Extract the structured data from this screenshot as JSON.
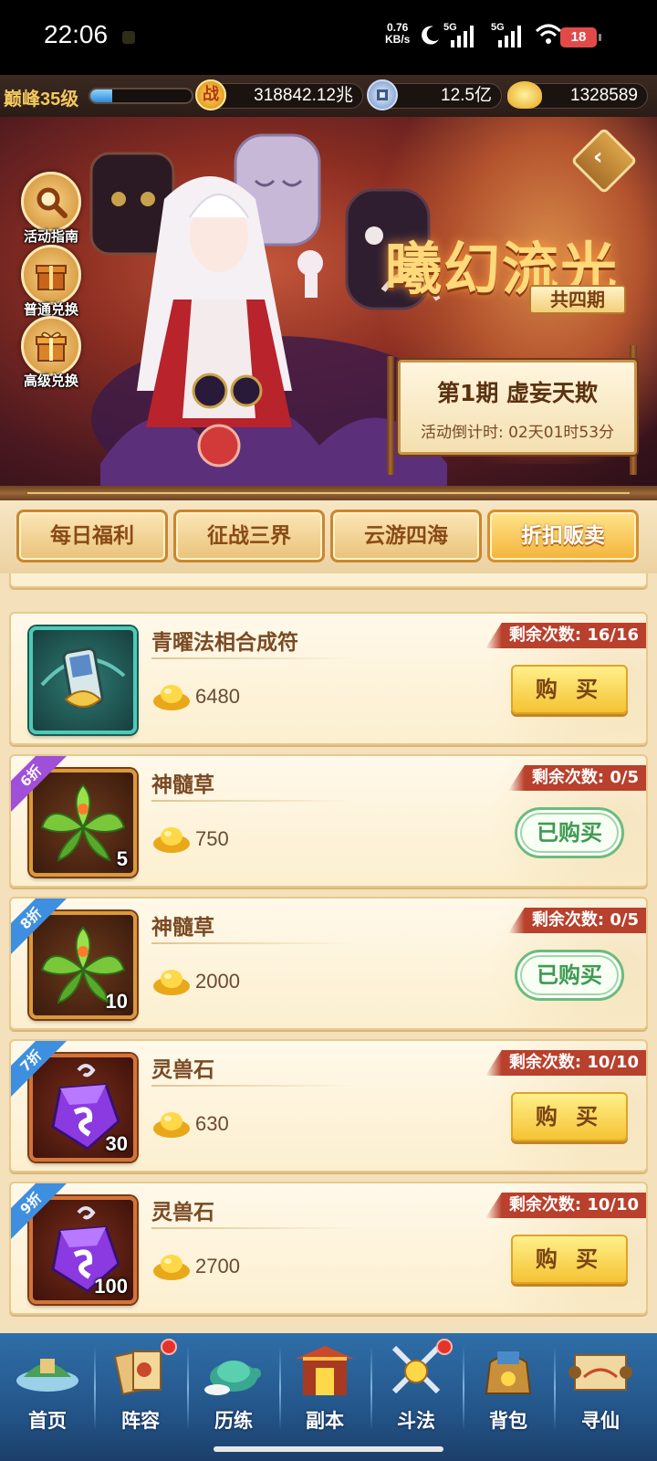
{
  "status_bar": {
    "time": "22:06",
    "net_speed_top": "0.76",
    "net_speed_bottom": "KB/s",
    "sig1_label": "5G",
    "sig2_label": "5G",
    "battery": "18"
  },
  "resources": {
    "level": "巅峰35级",
    "xp_fraction": 0.22,
    "power_icon": "战",
    "power": "318842.12兆",
    "coins": "12.5亿",
    "ingots": "1328589"
  },
  "banner": {
    "side_buttons": [
      {
        "label": "活动指南",
        "icon": "magnifier-icon"
      },
      {
        "label": "普通兑换",
        "icon": "gift-box-icon"
      },
      {
        "label": "高级兑换",
        "icon": "gift-box-icon"
      }
    ],
    "title": "曦幻流光",
    "subtitle": "共四期",
    "period_title": "第1期  虚妄天欺",
    "countdown": "活动倒计时: 02天01时53分"
  },
  "tabs": [
    {
      "label": "每日福利",
      "active": false
    },
    {
      "label": "征战三界",
      "active": false
    },
    {
      "label": "云游四海",
      "active": false
    },
    {
      "label": "折扣贩卖",
      "active": true
    }
  ],
  "shop_items": [
    {
      "name": "青曜法相合成符",
      "price": "6480",
      "remaining": "剩余次数: 16/16",
      "button": "购 买",
      "bought": false,
      "qty": "",
      "discount": "",
      "frame": "teal"
    },
    {
      "name": "神髓草",
      "price": "750",
      "remaining": "剩余次数: 0/5",
      "button": "已购买",
      "bought": true,
      "qty": "5",
      "discount": "6折",
      "frame": "brown"
    },
    {
      "name": "神髓草",
      "price": "2000",
      "remaining": "剩余次数: 0/5",
      "button": "已购买",
      "bought": true,
      "qty": "10",
      "discount": "8折",
      "frame": "brown"
    },
    {
      "name": "灵兽石",
      "price": "630",
      "remaining": "剩余次数: 10/10",
      "button": "购 买",
      "bought": false,
      "qty": "30",
      "discount": "7折",
      "frame": "red"
    },
    {
      "name": "灵兽石",
      "price": "2700",
      "remaining": "剩余次数: 10/10",
      "button": "购 买",
      "bought": false,
      "qty": "100",
      "discount": "9折",
      "frame": "red"
    }
  ],
  "bottom_nav": [
    {
      "label": "首页",
      "badge": false
    },
    {
      "label": "阵容",
      "badge": true
    },
    {
      "label": "历练",
      "badge": false
    },
    {
      "label": "副本",
      "badge": false
    },
    {
      "label": "斗法",
      "badge": true
    },
    {
      "label": "背包",
      "badge": false
    },
    {
      "label": "寻仙",
      "badge": false
    }
  ],
  "colors": {
    "accent_gold": "#f5c333",
    "remain_red": "#b8402c",
    "bought_green": "#3f9a52",
    "nav_blue": "#2f6ea8"
  }
}
